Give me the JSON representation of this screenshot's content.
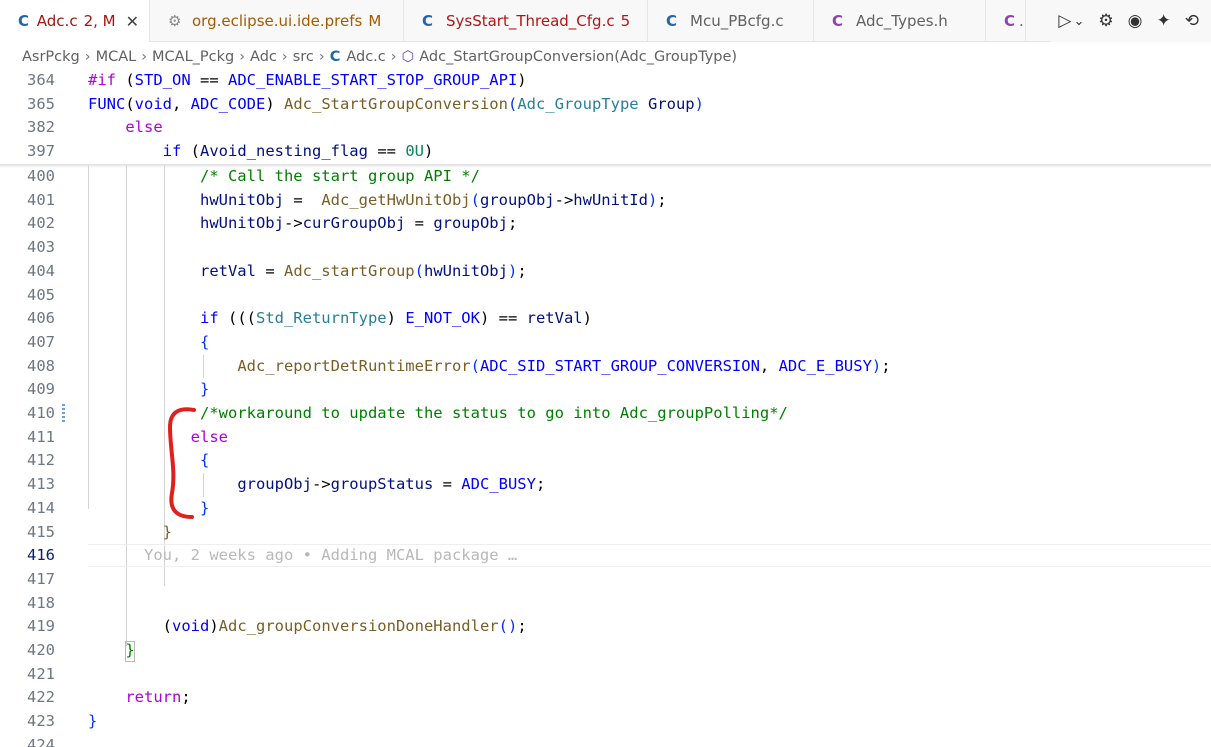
{
  "tabs": [
    {
      "icon": "C",
      "label": "Adc.c",
      "badge": "2, M",
      "close": "✕"
    },
    {
      "icon": "⚙",
      "label": "org.eclipse.ui.ide.prefs",
      "badge": "M"
    },
    {
      "icon": "C",
      "label": "SysStart_Thread_Cfg.c",
      "badge": "5"
    },
    {
      "icon": "C",
      "label": "Mcu_PBcfg.c"
    },
    {
      "icon": "C",
      "label": "Adc_Types.h"
    },
    {
      "icon": "C",
      "label": "."
    }
  ],
  "toolbar": {
    "run": "▷",
    "run_dropdown": "⌄",
    "gear": "⚙",
    "copilot": "◉",
    "sparkle": "✦",
    "history": "⟲"
  },
  "breadcrumb": {
    "items": [
      "AsrPckg",
      "MCAL",
      "MCAL_Pckg",
      "Adc",
      "src"
    ],
    "file_icon": "C",
    "file": "Adc.c",
    "symbol_icon": "⬡",
    "symbol": "Adc_StartGroupConversion(Adc_GroupType)",
    "separator": "›"
  },
  "editor": {
    "sticky": [
      {
        "num": "364",
        "tokens": [
          [
            "pp",
            "#if "
          ],
          [
            "txt",
            "("
          ],
          [
            "mac",
            "STD_ON"
          ],
          [
            "txt",
            " == "
          ],
          [
            "mac",
            "ADC_ENABLE_START_STOP_GROUP_API"
          ],
          [
            "txt",
            ")"
          ]
        ]
      },
      {
        "num": "365",
        "tokens": [
          [
            "mac",
            "FUNC"
          ],
          [
            "txt",
            "("
          ],
          [
            "kw",
            "void"
          ],
          [
            "txt",
            ", "
          ],
          [
            "mac",
            "ADC_CODE"
          ],
          [
            "txt",
            ") "
          ],
          [
            "fn",
            "Adc_StartGroupConversion"
          ],
          [
            "paren",
            "("
          ],
          [
            "ty",
            "Adc_GroupType"
          ],
          [
            "var",
            " Group"
          ],
          [
            "paren",
            ")"
          ]
        ]
      },
      {
        "num": "382",
        "tokens": [
          [
            "txt",
            "    "
          ],
          [
            "pp",
            "else"
          ]
        ]
      },
      {
        "num": "397",
        "tokens": [
          [
            "txt",
            "        "
          ],
          [
            "kw",
            "if"
          ],
          [
            "txt",
            " ("
          ],
          [
            "var",
            "Avoid_nesting_flag"
          ],
          [
            "txt",
            " == "
          ],
          [
            "num",
            "0U"
          ],
          [
            "txt",
            ")"
          ]
        ]
      }
    ],
    "lines": [
      {
        "num": "400",
        "tokens": [
          [
            "txt",
            "            "
          ],
          [
            "cmt",
            "/* Call the start group API */"
          ]
        ]
      },
      {
        "num": "401",
        "tokens": [
          [
            "txt",
            "            "
          ],
          [
            "var",
            "hwUnitObj"
          ],
          [
            "txt",
            " =  "
          ],
          [
            "fn",
            "Adc_getHwUnitObj"
          ],
          [
            "paren",
            "("
          ],
          [
            "var",
            "groupObj"
          ],
          [
            "txt",
            "->"
          ],
          [
            "var",
            "hwUnitId"
          ],
          [
            "paren",
            ")"
          ],
          [
            "txt",
            ";"
          ]
        ]
      },
      {
        "num": "402",
        "tokens": [
          [
            "txt",
            "            "
          ],
          [
            "var",
            "hwUnitObj"
          ],
          [
            "txt",
            "->"
          ],
          [
            "var",
            "curGroupObj"
          ],
          [
            "txt",
            " = "
          ],
          [
            "var",
            "groupObj"
          ],
          [
            "txt",
            ";"
          ]
        ]
      },
      {
        "num": "403",
        "tokens": []
      },
      {
        "num": "404",
        "tokens": [
          [
            "txt",
            "            "
          ],
          [
            "var",
            "retVal"
          ],
          [
            "txt",
            " = "
          ],
          [
            "fn",
            "Adc_startGroup"
          ],
          [
            "paren",
            "("
          ],
          [
            "var",
            "hwUnitObj"
          ],
          [
            "paren",
            ")"
          ],
          [
            "txt",
            ";"
          ]
        ]
      },
      {
        "num": "405",
        "tokens": []
      },
      {
        "num": "406",
        "tokens": [
          [
            "txt",
            "            "
          ],
          [
            "kw",
            "if"
          ],
          [
            "txt",
            " ((("
          ],
          [
            "ty",
            "Std_ReturnType"
          ],
          [
            "txt",
            ") "
          ],
          [
            "mac",
            "E_NOT_OK"
          ],
          [
            "txt",
            ") == "
          ],
          [
            "var",
            "retVal"
          ],
          [
            "txt",
            ")"
          ]
        ]
      },
      {
        "num": "407",
        "tokens": [
          [
            "txt",
            "            "
          ],
          [
            "paren",
            "{"
          ]
        ]
      },
      {
        "num": "408",
        "tokens": [
          [
            "txt",
            "                "
          ],
          [
            "fn",
            "Adc_reportDetRuntimeError"
          ],
          [
            "paren",
            "("
          ],
          [
            "mac",
            "ADC_SID_START_GROUP_CONVERSION"
          ],
          [
            "txt",
            ", "
          ],
          [
            "mac",
            "ADC_E_BUSY"
          ],
          [
            "paren",
            ")"
          ],
          [
            "txt",
            ";"
          ]
        ]
      },
      {
        "num": "409",
        "tokens": [
          [
            "txt",
            "            "
          ],
          [
            "paren",
            "}"
          ]
        ]
      },
      {
        "num": "410",
        "tokens": [
          [
            "txt",
            "            "
          ],
          [
            "cmt",
            "/*workaround to update the status to go into Adc_groupPolling*/"
          ]
        ]
      },
      {
        "num": "411",
        "tokens": [
          [
            "txt",
            "           "
          ],
          [
            "pp",
            "else"
          ]
        ]
      },
      {
        "num": "412",
        "tokens": [
          [
            "txt",
            "            "
          ],
          [
            "paren",
            "{"
          ]
        ]
      },
      {
        "num": "413",
        "tokens": [
          [
            "txt",
            "                "
          ],
          [
            "var",
            "groupObj"
          ],
          [
            "txt",
            "->"
          ],
          [
            "var",
            "groupStatus"
          ],
          [
            "txt",
            " = "
          ],
          [
            "mac",
            "ADC_BUSY"
          ],
          [
            "txt",
            ";"
          ]
        ]
      },
      {
        "num": "414",
        "tokens": [
          [
            "txt",
            "            "
          ],
          [
            "paren",
            "}"
          ]
        ]
      },
      {
        "num": "415",
        "tokens": [
          [
            "txt",
            "        "
          ],
          [
            "fn",
            "}"
          ]
        ]
      },
      {
        "num": "416",
        "tokens": [
          [
            "blame",
            "      You, 2 weeks ago • Adding MCAL package …"
          ]
        ],
        "current": true
      },
      {
        "num": "417",
        "tokens": []
      },
      {
        "num": "418",
        "tokens": []
      },
      {
        "num": "419",
        "tokens": [
          [
            "txt",
            "        "
          ],
          [
            "txt",
            "("
          ],
          [
            "kw",
            "void"
          ],
          [
            "txt",
            ")"
          ],
          [
            "fn",
            "Adc_groupConversionDoneHandler"
          ],
          [
            "paren",
            "()"
          ],
          [
            "txt",
            ";"
          ]
        ]
      },
      {
        "num": "420",
        "tokens": [
          [
            "txt",
            "    "
          ],
          [
            "cmt",
            "}"
          ]
        ]
      },
      {
        "num": "421",
        "tokens": []
      },
      {
        "num": "422",
        "tokens": [
          [
            "txt",
            "    "
          ],
          [
            "pp",
            "return"
          ],
          [
            "txt",
            ";"
          ]
        ]
      },
      {
        "num": "423",
        "tokens": [
          [
            "paren",
            "}"
          ]
        ]
      },
      {
        "num": "424",
        "tokens": []
      }
    ]
  },
  "colors": {
    "active_tab_text": "#a31515",
    "annotation": "#e0201c",
    "c_icon": "#2466a8",
    "h_icon": "#8e44ad"
  }
}
